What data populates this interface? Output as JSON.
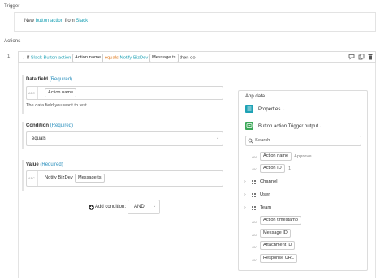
{
  "trigger": {
    "section_label": "Trigger",
    "text_prefix": "New",
    "text_link": "button action",
    "text_from": "from",
    "text_app": "Slack"
  },
  "actions": {
    "section_label": "Actions",
    "step_number": "1",
    "step": {
      "if_prefix": "If",
      "subject": "Slack Button action",
      "chip_field": "Action name",
      "operator": "equals",
      "value_text": "Notify BizDev",
      "chip_value": "Message ts",
      "then": "then do"
    }
  },
  "form": {
    "data_field": {
      "label": "Data field",
      "required": "(Required)",
      "type_tag": "ABC",
      "chip": "Action name",
      "help": "The data field you want to test"
    },
    "condition": {
      "label": "Condition",
      "required": "(Required)",
      "selected": "equals"
    },
    "value": {
      "label": "Value",
      "required": "(Required)",
      "type_tag": "ABC",
      "text": "Notify BizDev",
      "chip": "Message ts"
    },
    "add_condition": {
      "label": "Add condition:",
      "selected": "AND"
    }
  },
  "app_data": {
    "title": "App data",
    "properties_label": "Properties",
    "source_label": "Button action",
    "source_sub": "Trigger output",
    "search_placeholder": "Search",
    "items": {
      "action_name": {
        "type": "ABC",
        "label": "Action name",
        "value": "Approve"
      },
      "action_id": {
        "type": "ABC",
        "label": "Action ID",
        "value": "1"
      },
      "channel": {
        "label": "Channel"
      },
      "user": {
        "label": "User"
      },
      "team": {
        "label": "Team"
      },
      "action_timestamp": {
        "type": "ABC",
        "label": "Action timestamp"
      },
      "message_id": {
        "type": "ABC",
        "label": "Message ID"
      },
      "attachment_id": {
        "type": "ABC",
        "label": "Attachment ID"
      },
      "response_url": {
        "type": "ABC",
        "label": "Response URL"
      }
    }
  },
  "icons": {
    "step_toggle": "chevron-down-icon",
    "comment": "comment-icon",
    "copy": "copy-icon",
    "delete": "trash-icon",
    "add": "plus-circle-icon",
    "search": "search-icon",
    "properties": "list-icon",
    "slack": "slack-icon"
  },
  "colors": {
    "accent_teal": "#1fa2b5",
    "operator_orange": "#e07a1f",
    "required_blue": "#2a8fbd"
  }
}
